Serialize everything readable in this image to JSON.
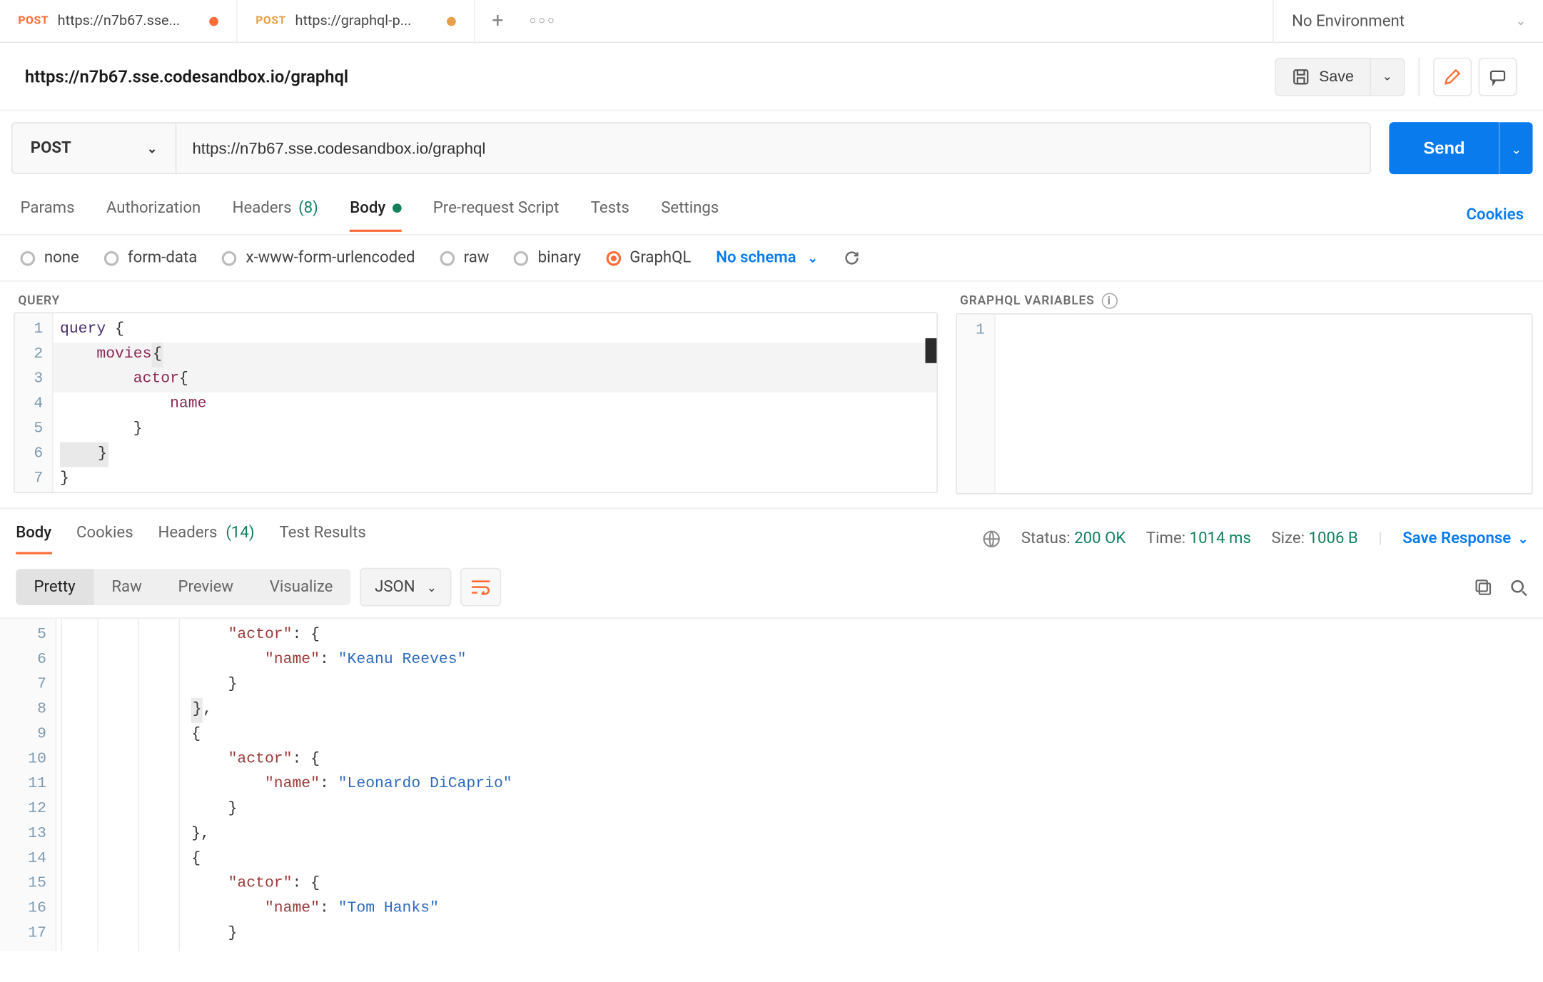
{
  "tabs": [
    {
      "method": "POST",
      "label": "https://n7b67.sse...",
      "dirty": true
    },
    {
      "method": "POST",
      "label": "https://graphql-p...",
      "dirty": true
    }
  ],
  "env": {
    "selected": "No Environment"
  },
  "title": "https://n7b67.sse.codesandbox.io/graphql",
  "saveBtn": "Save",
  "request": {
    "method": "POST",
    "url": "https://n7b67.sse.codesandbox.io/graphql",
    "sendLabel": "Send"
  },
  "subtabs": {
    "params": "Params",
    "auth": "Authorization",
    "headers": "Headers",
    "headersCount": "(8)",
    "body": "Body",
    "prereq": "Pre-request Script",
    "tests": "Tests",
    "settings": "Settings",
    "cookies": "Cookies"
  },
  "bodyTypes": {
    "none": "none",
    "formdata": "form-data",
    "xwww": "x-www-form-urlencoded",
    "raw": "raw",
    "binary": "binary",
    "graphql": "GraphQL",
    "noschema": "No schema"
  },
  "panels": {
    "query": "QUERY",
    "vars": "GRAPHQL VARIABLES"
  },
  "query": {
    "lineNums": [
      "1",
      "2",
      "3",
      "4",
      "5",
      "6",
      "7"
    ],
    "l1_kw": "query",
    "l1_brace": " {",
    "l2_indent": "    ",
    "l2_field": "movies",
    "l2_brace": "{",
    "l3_indent": "        ",
    "l3_field": "actor",
    "l3_brace": "{",
    "l4_indent": "            ",
    "l4_field": "name",
    "l5": "        }",
    "l6": "    }",
    "l7": "}"
  },
  "vars": {
    "lineNums": [
      "1"
    ]
  },
  "respTabs": {
    "body": "Body",
    "cookies": "Cookies",
    "headers": "Headers",
    "headersCount": "(14)",
    "tests": "Test Results"
  },
  "status": {
    "statusLabel": "Status:",
    "statusValue": "200 OK",
    "timeLabel": "Time:",
    "timeValue": "1014 ms",
    "sizeLabel": "Size:",
    "sizeValue": "1006 B",
    "saveResp": "Save Response"
  },
  "viewSeg": {
    "pretty": "Pretty",
    "raw": "Raw",
    "preview": "Preview",
    "visualize": "Visualize"
  },
  "format": "JSON",
  "response": {
    "lineNums": [
      "5",
      "6",
      "7",
      "8",
      "9",
      "10",
      "11",
      "12",
      "13",
      "14",
      "15",
      "16",
      "17"
    ],
    "actorKey": "\"actor\"",
    "nameKey": "\"name\"",
    "n1": "\"Keanu Reeves\"",
    "n2": "\"Leonardo DiCaprio\"",
    "n3": "\"Tom Hanks\""
  }
}
